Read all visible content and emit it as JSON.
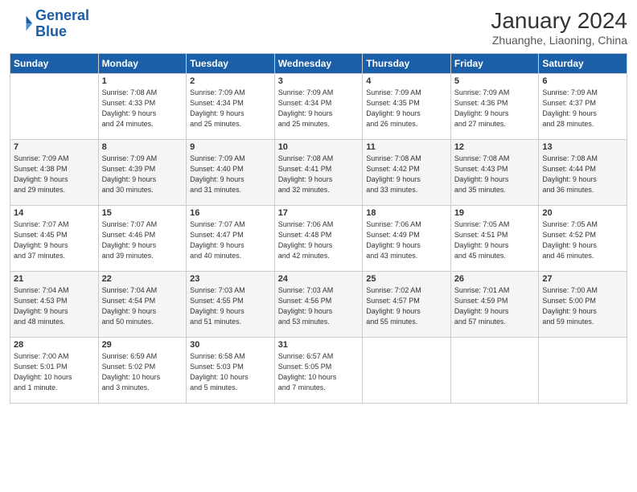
{
  "logo": {
    "line1": "General",
    "line2": "Blue"
  },
  "title": "January 2024",
  "subtitle": "Zhuanghe, Liaoning, China",
  "days_of_week": [
    "Sunday",
    "Monday",
    "Tuesday",
    "Wednesday",
    "Thursday",
    "Friday",
    "Saturday"
  ],
  "weeks": [
    [
      {
        "num": "",
        "info": ""
      },
      {
        "num": "1",
        "info": "Sunrise: 7:08 AM\nSunset: 4:33 PM\nDaylight: 9 hours\nand 24 minutes."
      },
      {
        "num": "2",
        "info": "Sunrise: 7:09 AM\nSunset: 4:34 PM\nDaylight: 9 hours\nand 25 minutes."
      },
      {
        "num": "3",
        "info": "Sunrise: 7:09 AM\nSunset: 4:34 PM\nDaylight: 9 hours\nand 25 minutes."
      },
      {
        "num": "4",
        "info": "Sunrise: 7:09 AM\nSunset: 4:35 PM\nDaylight: 9 hours\nand 26 minutes."
      },
      {
        "num": "5",
        "info": "Sunrise: 7:09 AM\nSunset: 4:36 PM\nDaylight: 9 hours\nand 27 minutes."
      },
      {
        "num": "6",
        "info": "Sunrise: 7:09 AM\nSunset: 4:37 PM\nDaylight: 9 hours\nand 28 minutes."
      }
    ],
    [
      {
        "num": "7",
        "info": "Sunrise: 7:09 AM\nSunset: 4:38 PM\nDaylight: 9 hours\nand 29 minutes."
      },
      {
        "num": "8",
        "info": "Sunrise: 7:09 AM\nSunset: 4:39 PM\nDaylight: 9 hours\nand 30 minutes."
      },
      {
        "num": "9",
        "info": "Sunrise: 7:09 AM\nSunset: 4:40 PM\nDaylight: 9 hours\nand 31 minutes."
      },
      {
        "num": "10",
        "info": "Sunrise: 7:08 AM\nSunset: 4:41 PM\nDaylight: 9 hours\nand 32 minutes."
      },
      {
        "num": "11",
        "info": "Sunrise: 7:08 AM\nSunset: 4:42 PM\nDaylight: 9 hours\nand 33 minutes."
      },
      {
        "num": "12",
        "info": "Sunrise: 7:08 AM\nSunset: 4:43 PM\nDaylight: 9 hours\nand 35 minutes."
      },
      {
        "num": "13",
        "info": "Sunrise: 7:08 AM\nSunset: 4:44 PM\nDaylight: 9 hours\nand 36 minutes."
      }
    ],
    [
      {
        "num": "14",
        "info": "Sunrise: 7:07 AM\nSunset: 4:45 PM\nDaylight: 9 hours\nand 37 minutes."
      },
      {
        "num": "15",
        "info": "Sunrise: 7:07 AM\nSunset: 4:46 PM\nDaylight: 9 hours\nand 39 minutes."
      },
      {
        "num": "16",
        "info": "Sunrise: 7:07 AM\nSunset: 4:47 PM\nDaylight: 9 hours\nand 40 minutes."
      },
      {
        "num": "17",
        "info": "Sunrise: 7:06 AM\nSunset: 4:48 PM\nDaylight: 9 hours\nand 42 minutes."
      },
      {
        "num": "18",
        "info": "Sunrise: 7:06 AM\nSunset: 4:49 PM\nDaylight: 9 hours\nand 43 minutes."
      },
      {
        "num": "19",
        "info": "Sunrise: 7:05 AM\nSunset: 4:51 PM\nDaylight: 9 hours\nand 45 minutes."
      },
      {
        "num": "20",
        "info": "Sunrise: 7:05 AM\nSunset: 4:52 PM\nDaylight: 9 hours\nand 46 minutes."
      }
    ],
    [
      {
        "num": "21",
        "info": "Sunrise: 7:04 AM\nSunset: 4:53 PM\nDaylight: 9 hours\nand 48 minutes."
      },
      {
        "num": "22",
        "info": "Sunrise: 7:04 AM\nSunset: 4:54 PM\nDaylight: 9 hours\nand 50 minutes."
      },
      {
        "num": "23",
        "info": "Sunrise: 7:03 AM\nSunset: 4:55 PM\nDaylight: 9 hours\nand 51 minutes."
      },
      {
        "num": "24",
        "info": "Sunrise: 7:03 AM\nSunset: 4:56 PM\nDaylight: 9 hours\nand 53 minutes."
      },
      {
        "num": "25",
        "info": "Sunrise: 7:02 AM\nSunset: 4:57 PM\nDaylight: 9 hours\nand 55 minutes."
      },
      {
        "num": "26",
        "info": "Sunrise: 7:01 AM\nSunset: 4:59 PM\nDaylight: 9 hours\nand 57 minutes."
      },
      {
        "num": "27",
        "info": "Sunrise: 7:00 AM\nSunset: 5:00 PM\nDaylight: 9 hours\nand 59 minutes."
      }
    ],
    [
      {
        "num": "28",
        "info": "Sunrise: 7:00 AM\nSunset: 5:01 PM\nDaylight: 10 hours\nand 1 minute."
      },
      {
        "num": "29",
        "info": "Sunrise: 6:59 AM\nSunset: 5:02 PM\nDaylight: 10 hours\nand 3 minutes."
      },
      {
        "num": "30",
        "info": "Sunrise: 6:58 AM\nSunset: 5:03 PM\nDaylight: 10 hours\nand 5 minutes."
      },
      {
        "num": "31",
        "info": "Sunrise: 6:57 AM\nSunset: 5:05 PM\nDaylight: 10 hours\nand 7 minutes."
      },
      {
        "num": "",
        "info": ""
      },
      {
        "num": "",
        "info": ""
      },
      {
        "num": "",
        "info": ""
      }
    ]
  ]
}
